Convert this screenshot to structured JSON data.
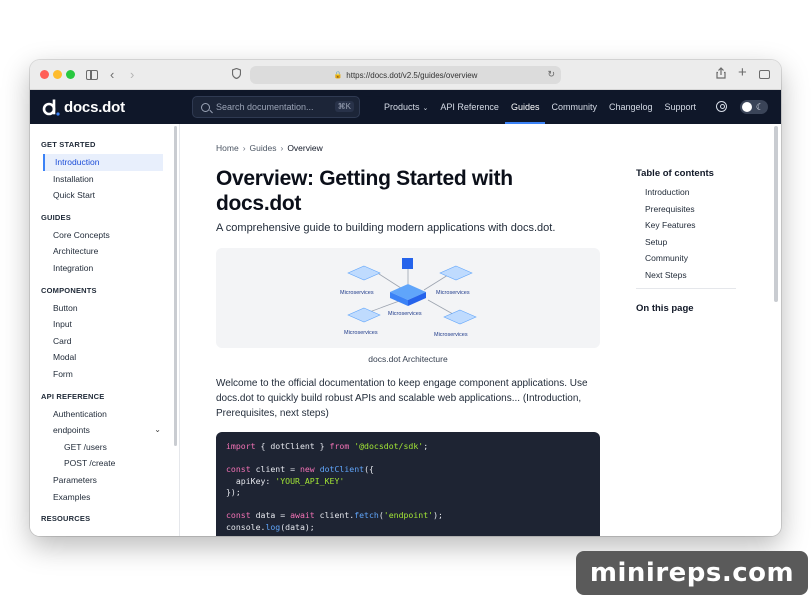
{
  "browser": {
    "url": "https://docs.dot/v2.5/guides/overview"
  },
  "header": {
    "logo_text": "docs.dot",
    "search_placeholder": "Search documentation...",
    "search_shortcut": "⌘K",
    "nav": [
      {
        "label": "Products",
        "has_dropdown": true
      },
      {
        "label": "API Reference"
      },
      {
        "label": "Guides",
        "active": true
      },
      {
        "label": "Community"
      },
      {
        "label": "Changelog"
      },
      {
        "label": "Support"
      }
    ]
  },
  "sidebar": {
    "sections": [
      {
        "title": "GET STARTED",
        "items": [
          "Introduction",
          "Installation",
          "Quick Start"
        ]
      },
      {
        "title": "GUIDES",
        "items": [
          "Core Concepts",
          "Architecture",
          "Integration"
        ]
      },
      {
        "title": "COMPONENTS",
        "items": [
          "Button",
          "Input",
          "Card",
          "Modal",
          "Form"
        ]
      },
      {
        "title": "API REFERENCE",
        "items": [
          "Authentication",
          "endpoints",
          "GET /users",
          "POST /create",
          "Parameters",
          "Examples"
        ]
      },
      {
        "title": "RESOURCES",
        "items": []
      }
    ],
    "active_item": "Introduction"
  },
  "main": {
    "breadcrumb": [
      "Home",
      "Guides",
      "Overview"
    ],
    "title": "Overview: Getting Started with docs.dot",
    "subtitle": "A comprehensive guide to building modern applications with docs.dot.",
    "figure": {
      "labels": [
        "Microservices",
        "Microservices",
        "Microservices",
        "Microservices",
        "Microservices"
      ],
      "caption": "docs.dot Architecture"
    },
    "paragraph": "Welcome to the official documentation to keep engage component applications. Use docs.dot to quickly build robust APIs and scalable web applications... (Introduction, Prerequisites, next steps)",
    "code": {
      "import_kw": "import",
      "import_body": " { dotClient } ",
      "from_kw": "from",
      "import_src": "'@docsdot/sdk'",
      "const1": "const",
      "client_var": " client = ",
      "new_kw": "new",
      "client_ctor": "dotClient",
      "open_brace": "({",
      "apikey_key": "  apiKey: ",
      "apikey_val": "'YOUR_API_KEY'",
      "close": "});",
      "const2": "const",
      "data_var": " data = ",
      "await_kw": "await",
      "client_obj": " client.",
      "fetch_fn": "fetch",
      "fetch_arg": "'endpoint'",
      "fetch_end": ");",
      "console_obj": "console.",
      "log_fn": "log",
      "log_end": "(data);"
    }
  },
  "toc": {
    "title": "Table of contents",
    "items": [
      "Introduction",
      "Prerequisites",
      "Key Features",
      "Setup",
      "Community",
      "Next Steps"
    ],
    "on_this_page": "On this page"
  },
  "watermark": "minireps.com",
  "colors": {
    "header_bg": "#0f1729",
    "accent": "#3b82f6",
    "code_bg": "#1e2433"
  }
}
